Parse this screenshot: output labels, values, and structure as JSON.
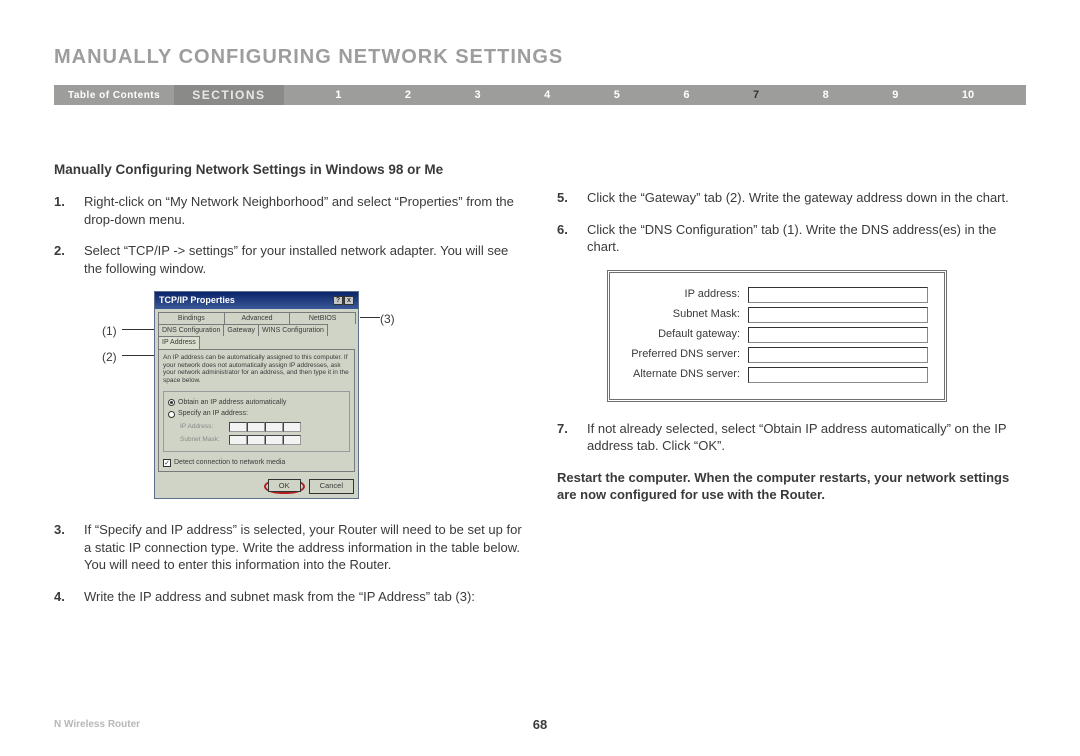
{
  "title": "MANUALLY CONFIGURING NETWORK SETTINGS",
  "nav": {
    "toc": "Table of Contents",
    "sections": "SECTIONS",
    "items": [
      "1",
      "2",
      "3",
      "4",
      "5",
      "6",
      "7",
      "8",
      "9",
      "10"
    ],
    "active": "7"
  },
  "subhead": "Manually Configuring Network Settings in Windows 98 or Me",
  "steps_left": [
    {
      "n": "1.",
      "t": "Right-click on “My Network Neighborhood” and select “Properties” from the drop-down menu."
    },
    {
      "n": "2.",
      "t": "Select “TCP/IP -> settings” for your installed network adapter. You will see the following window."
    },
    {
      "n": "3.",
      "t": "If “Specify and IP address” is selected, your Router will need to be set up for a static IP connection type. Write the address information in the table below. You will need to enter this information into the Router."
    },
    {
      "n": "4.",
      "t": "Write the IP address and subnet mask from the “IP Address” tab (3):"
    }
  ],
  "steps_right": [
    {
      "n": "5.",
      "t": "Click the “Gateway” tab (2). Write the gateway address down in the chart."
    },
    {
      "n": "6.",
      "t": "Click the “DNS Configuration” tab (1). Write the DNS address(es) in the chart."
    },
    {
      "n": "7.",
      "t": "If not already selected, select “Obtain IP address automatically” on the IP address tab. Click “OK”."
    }
  ],
  "restart": "Restart the computer. When the computer restarts, your network settings are now configured for use with the Router.",
  "callouts": {
    "c1": "(1)",
    "c2": "(2)",
    "c3": "(3)"
  },
  "dialog": {
    "title": "TCP/IP Properties",
    "tabs_row1": [
      "Bindings",
      "Advanced",
      "NetBIOS"
    ],
    "tabs_row2": [
      "DNS Configuration",
      "Gateway",
      "WINS Configuration",
      "IP Address"
    ],
    "info": "An IP address can be automatically assigned to this computer. If your network does not automatically assign IP addresses, ask your network administrator for an address, and then type it in the space below.",
    "radio1": "Obtain an IP address automatically",
    "radio2": "Specify an IP address:",
    "ip_label": "IP Address:",
    "mask_label": "Subnet Mask:",
    "detect": "Detect connection to network media",
    "ok": "OK",
    "cancel": "Cancel"
  },
  "ipform": {
    "rows": [
      "IP address:",
      "Subnet Mask:",
      "Default gateway:",
      "Preferred DNS server:",
      "Alternate DNS server:"
    ]
  },
  "footer": {
    "product": "N Wireless Router",
    "page": "68"
  }
}
